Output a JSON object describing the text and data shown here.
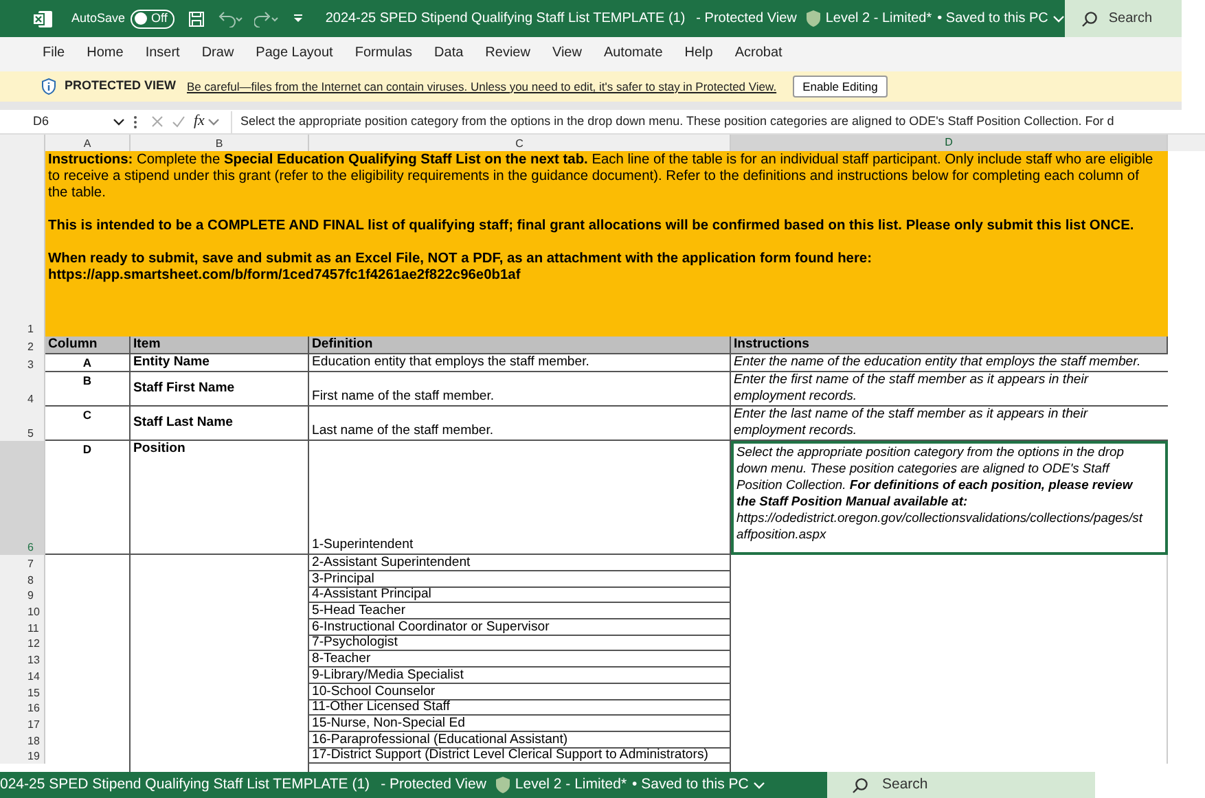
{
  "title_bar": {
    "autosave_label": "AutoSave",
    "autosave_on": false,
    "autosave_state": "Off",
    "title": "2024-25 SPED Stipend Qualifying Staff List TEMPLATE (1)",
    "view": "- Protected View",
    "sensitivity": "Level 2 - Limited*",
    "saved": "• Saved to this PC",
    "search_placeholder": "Search"
  },
  "ribbon_tabs": [
    {
      "label": "File",
      "selected": false
    },
    {
      "label": "Home",
      "selected": false
    },
    {
      "label": "Insert",
      "selected": false
    },
    {
      "label": "Draw",
      "selected": false
    },
    {
      "label": "Page Layout",
      "selected": false
    },
    {
      "label": "Formulas",
      "selected": false
    },
    {
      "label": "Data",
      "selected": false
    },
    {
      "label": "Review",
      "selected": false
    },
    {
      "label": "View",
      "selected": false
    },
    {
      "label": "Automate",
      "selected": false
    },
    {
      "label": "Help",
      "selected": false
    },
    {
      "label": "Acrobat",
      "selected": false
    }
  ],
  "protected_view": {
    "label": "PROTECTED VIEW",
    "message": "Be careful—files from the Internet can contain viruses. Unless you need to edit, it's safer to stay in Protected View.",
    "button": "Enable Editing"
  },
  "formula_bar": {
    "cell_ref": "D6",
    "fx": "fx",
    "formula": "Select the appropriate position category from the options in the drop down menu. These position categories are aligned to ODE's Staff Position Collection. For d"
  },
  "column_headers": [
    {
      "label": "A",
      "selected": false
    },
    {
      "label": "B",
      "selected": false
    },
    {
      "label": "C",
      "selected": false
    },
    {
      "label": "D",
      "selected": true
    }
  ],
  "instructions": {
    "row": "1",
    "paragraphs": [
      {
        "text": "**Instructions:** Complete the **Special Education Qualifying Staff List on the next tab.** Each line of the table is for an individual staff participant. Only include staff who are eligible to receive a stipend under this grant (refer to the eligibility requirements in the guidance document). Refer to the definitions and instructions below for completing each column of the table.",
        "bold": false
      },
      {
        "text": "This is intended to be a COMPLETE AND FINAL list of qualifying staff; final grant allocations will be confirmed based on this list. Please only submit this list ONCE.",
        "bold": true
      },
      {
        "text": "When ready to submit, save and submit as an Excel File, NOT a PDF, as an attachment with the application form found here:",
        "bold": true
      },
      {
        "text": "https://app.smartsheet.com/b/form/1ced7457fc1f4261ae2f822c96e0b1af",
        "bold": true
      }
    ]
  },
  "table": {
    "header": {
      "row": "2",
      "cells": [
        "Column",
        "Item",
        "Definition",
        "Instructions"
      ]
    },
    "rows": [
      {
        "row": "3",
        "column": "A",
        "item": "Entity Name",
        "definition": "Education entity that employs the staff member.",
        "instructions": "Enter the name of the education entity that employs the staff member.",
        "selected": false
      },
      {
        "row": "4",
        "column": "B",
        "item": "Staff First Name",
        "definition": "First name of the staff member.",
        "instructions": "Enter the first name of the staff member as it appears in their employment records.",
        "selected": false
      },
      {
        "row": "5",
        "column": "C",
        "item": "Staff Last Name",
        "definition": "Last name of the staff member.",
        "instructions": "Enter the last name of the staff member as it appears in their employment records.",
        "selected": false
      },
      {
        "row": "6",
        "column": "D",
        "item": "Position",
        "definition": "1-Superintendent",
        "instructions": "Select the appropriate position category from the options in the drop down menu. These position categories are aligned to ODE's Staff Position Collection.  **For definitions of each position, please review the Staff Position Manual available at:** *https://odedistrict.oregon.gov/collectionsvalidations/collections/pages/staffposition.aspx*",
        "selected": true
      }
    ]
  },
  "position_list": [
    {
      "row": "7",
      "text": "2-Assistant Superintendent"
    },
    {
      "row": "8",
      "text": "3-Principal"
    },
    {
      "row": "9",
      "text": "4-Assistant Principal"
    },
    {
      "row": "10",
      "text": "5-Head Teacher"
    },
    {
      "row": "11",
      "text": "6-Instructional Coordinator or Supervisor"
    },
    {
      "row": "12",
      "text": "7-Psychologist"
    },
    {
      "row": "13",
      "text": "8-Teacher"
    },
    {
      "row": "14",
      "text": "9-Library/Media Specialist"
    },
    {
      "row": "15",
      "text": "10-School Counselor"
    },
    {
      "row": "16",
      "text": "11-Other Licensed Staff"
    },
    {
      "row": "17",
      "text": "15-Nurse, Non-Special Ed"
    },
    {
      "row": "18",
      "text": "16-Paraprofessional (Educational Assistant)"
    },
    {
      "row": "19",
      "text": "17-District Support (District Level Clerical Support to Administrators)"
    }
  ],
  "overlay_title_bar": {
    "title": "024-25 SPED Stipend Qualifying Staff List TEMPLATE (1)",
    "view": "- Protected View",
    "sensitivity": "Level 2 - Limited*",
    "saved": "• Saved to this PC",
    "search_placeholder": "Search"
  }
}
